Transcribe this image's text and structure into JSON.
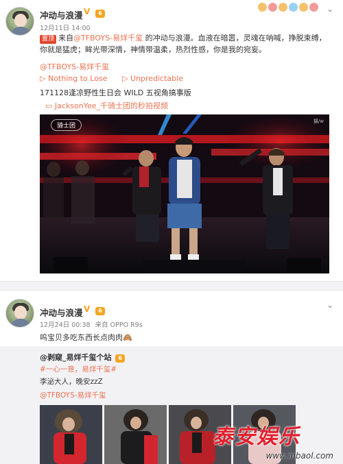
{
  "post1": {
    "username": "冲动与浪漫",
    "verified_mark": "V",
    "level_badge": "6",
    "timestamp": "12月11日 14:00",
    "top_tag": "置顶",
    "content_prefix": "来自",
    "content_mention": "@TFBOYS-易烊千玺",
    "content_body": "的冲动与浪漫。血液在暗嚣，灵魂在呐喊，挣脱束缚，你就是猛虎；眸光带深情，神情带温柔，热烈性感，你是我的宛妄。",
    "mention_line": "@TFBOYS-易烊千玺",
    "music": [
      {
        "icon": "▷",
        "title": "Nothing to Lose"
      },
      {
        "icon": "▷",
        "title": "Unpredictable"
      }
    ],
    "video_title": "171128逢凉野性生日会 WILD 五视角搞事版",
    "video_link_icon": "▭",
    "video_link": "JacksonYee_千骑士团的秒拍视频",
    "video_badge": "骑士团",
    "video_corner": "摄/w"
  },
  "post2": {
    "username": "冲动与浪漫",
    "verified_mark": "V",
    "level_badge": "6",
    "timestamp": "12月24日 00:38",
    "source": "来自 OPPO R9s",
    "content": "呜宝贝多吃东西长点肉肉🙈",
    "repost": {
      "username": "@剥窥_易烊千玺个站",
      "level_badge": "6",
      "hashtag": "#一心一意，易烊千玺#",
      "text": "李泌大人，晚安zzZ",
      "mention": "@TFBOYS-易烊千玺"
    }
  },
  "watermark": {
    "title": "泰安娱乐",
    "url": "www.inbaol.com"
  }
}
